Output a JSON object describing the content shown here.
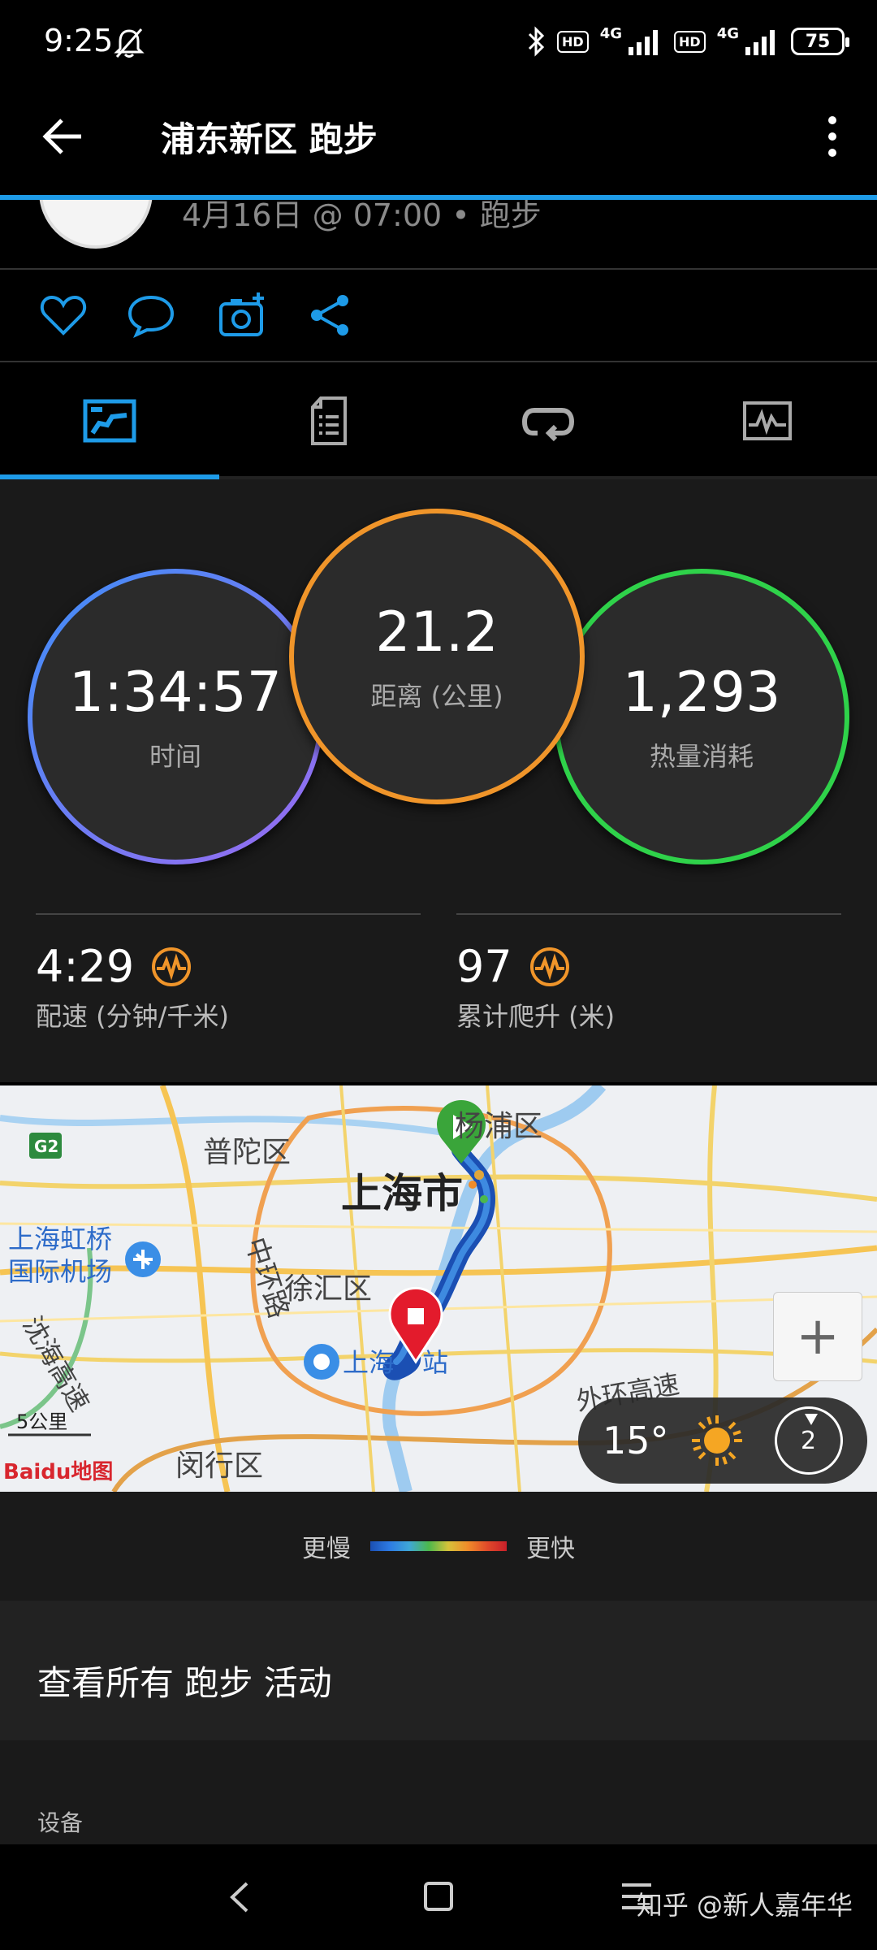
{
  "status_bar": {
    "time": "9:25",
    "hd1": "HD",
    "net1": "4G",
    "hd2": "HD",
    "net2": "4G",
    "battery": "75"
  },
  "app_bar": {
    "title": "浦东新区 跑步"
  },
  "header": {
    "subtitle": "4月16日 @ 07:00 • 跑步"
  },
  "stats": {
    "time": {
      "value": "1:34:57",
      "label": "时间"
    },
    "distance": {
      "value": "21.2",
      "label": "距离 (公里)"
    },
    "calories": {
      "value": "1,293",
      "label": "热量消耗"
    },
    "pace": {
      "value": "4:29",
      "label": "配速 (分钟/千米)"
    },
    "ascent": {
      "value": "97",
      "label": "累计爬升 (米)"
    }
  },
  "colors": {
    "accent": "#1e9be8",
    "ring_time": "#6f6ef0",
    "ring_distance": "#f0952a",
    "ring_calories": "#2fd24a",
    "perf_icon": "#f0952a"
  },
  "map": {
    "labels": [
      "杨浦区",
      "普陀区",
      "上海市",
      "上海虹桥",
      "国际机场",
      "中环路",
      "徐汇区",
      "上海",
      "站",
      "沈海高速",
      "外环高速",
      "闵行区",
      "5公里",
      "G2"
    ],
    "logo": "Baidu地图",
    "zoom_in": "+",
    "weather": {
      "temp": "15°",
      "wind": "2"
    }
  },
  "legend": {
    "slower": "更慢",
    "faster": "更快"
  },
  "view_all": "查看所有 跑步 活动",
  "device_section": "设备",
  "watermark": "知乎 @新人嘉年华"
}
